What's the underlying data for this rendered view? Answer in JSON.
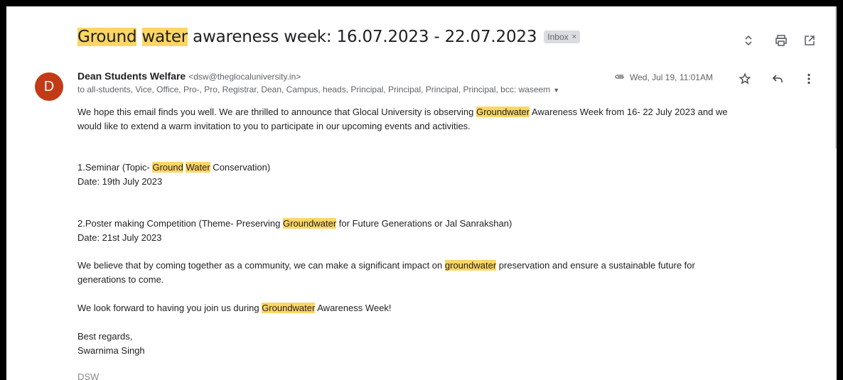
{
  "subject": {
    "parts": [
      "Ground",
      " ",
      "water",
      " awareness week: 16.07.2023 - 22.07.2023"
    ],
    "badge": "Inbox",
    "badge_close": "×"
  },
  "toolbar": {
    "icons": [
      "expand-collapse-icon",
      "print-icon",
      "open-in-new-window-icon"
    ]
  },
  "sender": {
    "avatar_letter": "D",
    "avatar_color": "#c23b16",
    "name": "Dean Students Welfare",
    "email": "<dsw@theglocaluniversity.in>",
    "recipients": "to all-students, Vice, Office, Pro-, Pro, Registrar, Dean, Campus, heads, Principal, Principal, Principal, Principal, bcc: waseem",
    "date": "Wed, Jul 19, 11:01AM"
  },
  "body": {
    "p1": [
      "We hope this email finds you well. We are thrilled to announce that Glocal University is observing ",
      "Groundwater",
      " Awareness Week from 16- 22 July 2023  and we",
      "would like to extend a warm invitation to you to participate in our upcoming events and activities."
    ],
    "event1": [
      "1.Seminar (Topic- ",
      "Ground",
      " ",
      "Water",
      " Conservation)"
    ],
    "event1_date": "Date: 19th July 2023",
    "event2": [
      "2.Poster making Competition (Theme- Preserving ",
      "Groundwater",
      " for Future Generations or Jal Sanrakshan)"
    ],
    "event2_date": "Date: 21st July 2023",
    "p2": [
      "We believe that by coming together as a community, we can make a significant impact on ",
      "groundwater",
      " preservation and ensure a sustainable future for",
      "generations to come."
    ],
    "p3": [
      "We look forward to having you join us during ",
      "Groundwater",
      " Awareness Week!"
    ],
    "closing": "Best regards,",
    "signature_name": "Swarnima Singh",
    "signature_title": "DSW"
  },
  "colors": {
    "highlight": "#fdd663",
    "avatar": "#c23b16"
  }
}
